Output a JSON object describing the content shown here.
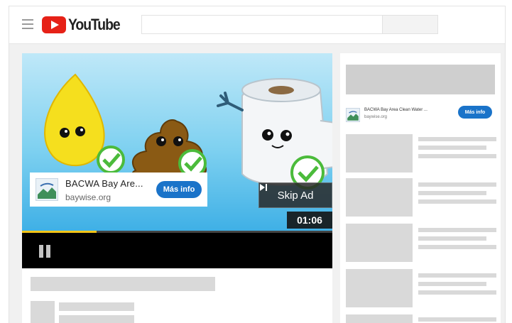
{
  "header": {
    "logo_text": "YouTube",
    "search_placeholder": ""
  },
  "player": {
    "ad_card": {
      "title": "BACWA Bay Are...",
      "url": "baywise.org",
      "button_label": "Más info"
    },
    "skip_label": "Skip Ad",
    "time": "01:06",
    "progress_fraction": 0.24
  },
  "sidebar": {
    "ad": {
      "title": "BACWA Bay Area Clean Water ...",
      "url": "baywise.org",
      "button_label": "Más info"
    }
  },
  "colors": {
    "brand_red": "#e62117",
    "cta_blue": "#1a73c9",
    "progress": "#f5c518"
  },
  "icons": [
    "hamburger-icon",
    "youtube-play-icon",
    "skip-icon",
    "pause-icon",
    "ad-thumbnail-icon"
  ]
}
